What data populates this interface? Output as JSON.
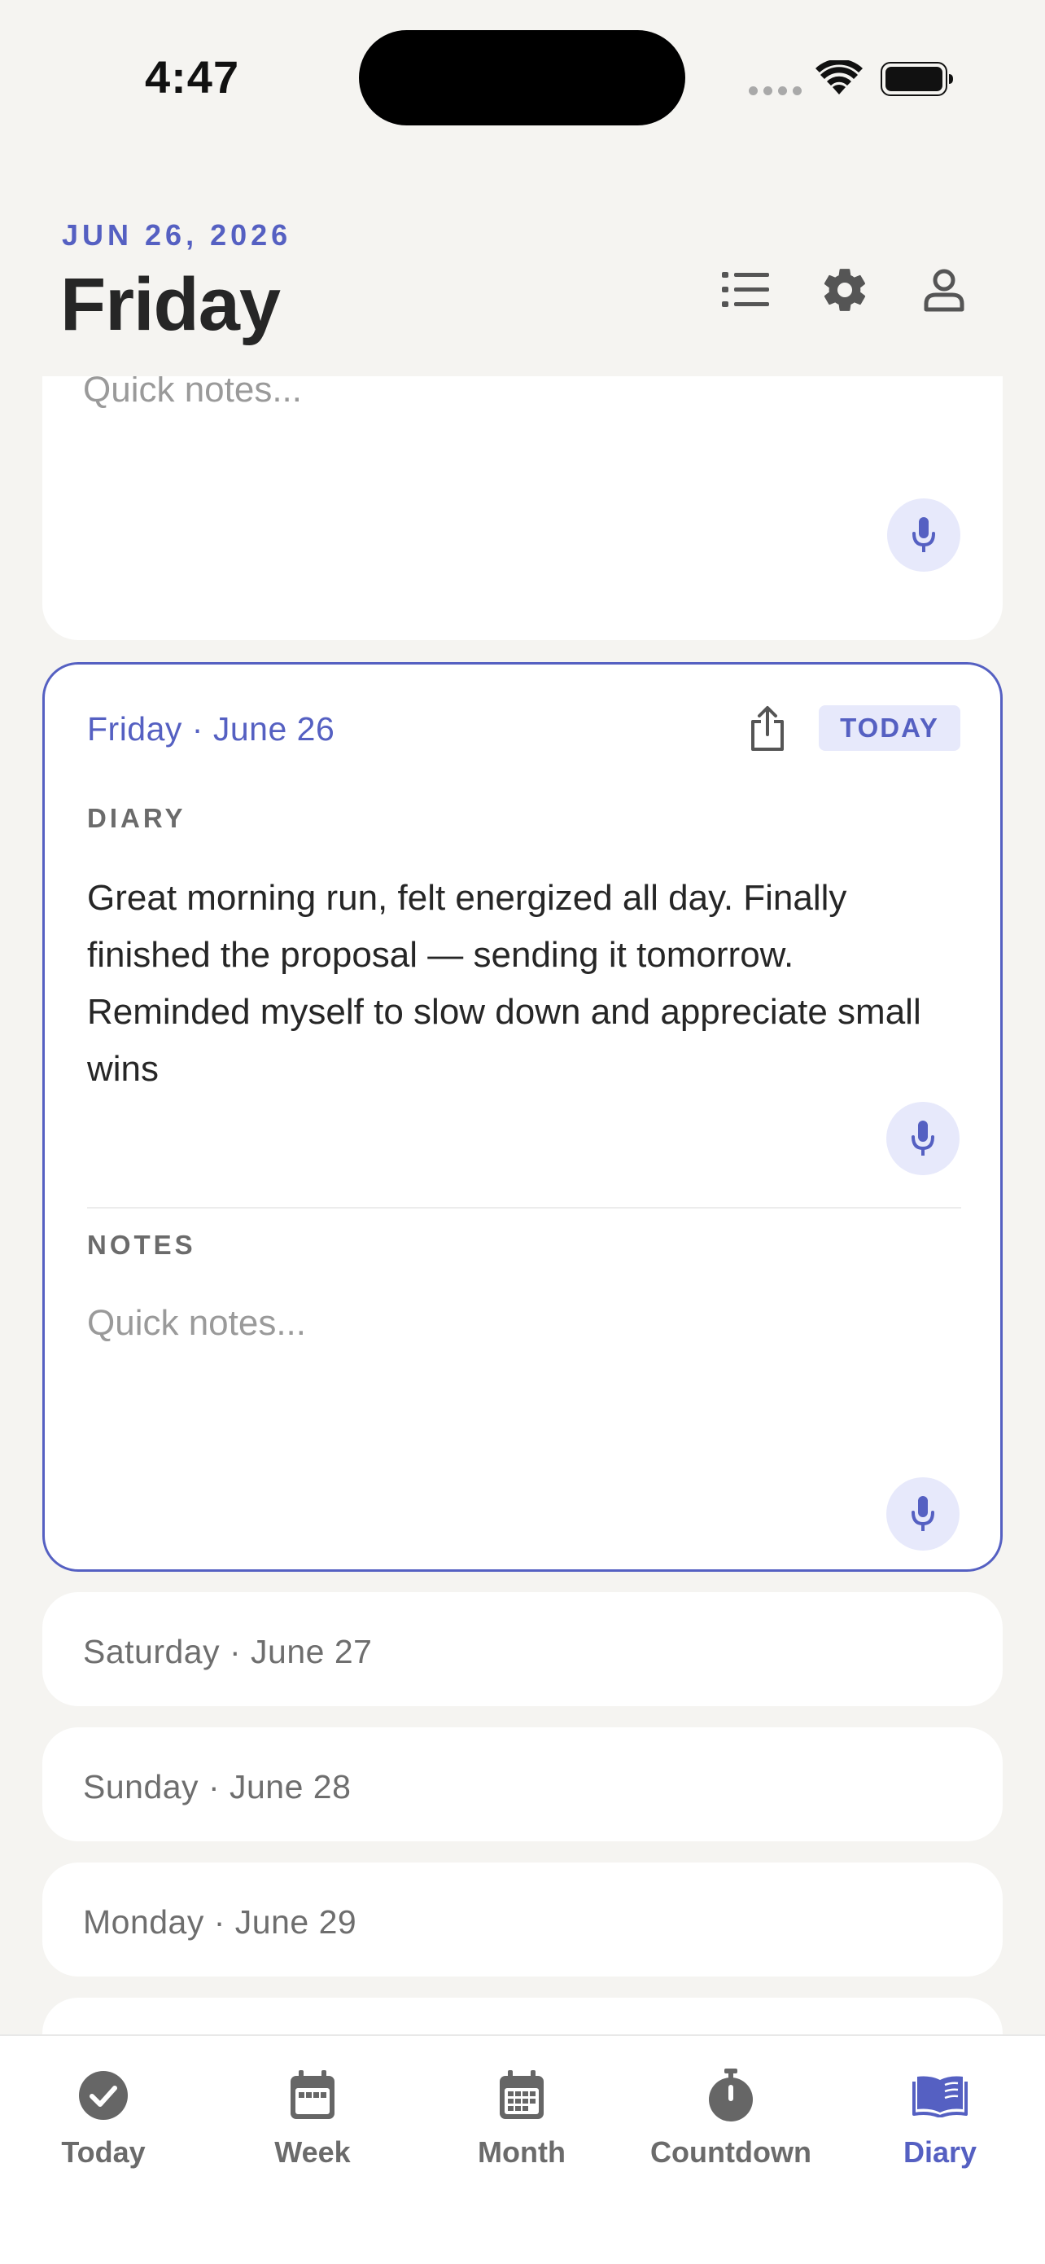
{
  "status_bar": {
    "time": "4:47"
  },
  "header": {
    "date": "JUN 26, 2026",
    "day": "Friday",
    "icons": [
      "list-icon",
      "gear-icon",
      "person-icon"
    ]
  },
  "colors": {
    "accent": "#5560c2",
    "accent_light": "#e7e9fb",
    "background": "#f5f4f1",
    "card": "#ffffff"
  },
  "prev_card": {
    "notes_placeholder": "Quick notes..."
  },
  "active_card": {
    "title": "Friday · June 26",
    "badge": "TODAY",
    "diary_label": "DIARY",
    "diary_text": "Great morning run, felt energized all day. Finally finished the proposal — sending it tomorrow. Reminded myself to slow down and appreciate small wins",
    "notes_label": "NOTES",
    "notes_placeholder": "Quick notes..."
  },
  "day_cards": [
    {
      "label": "Saturday · June 27"
    },
    {
      "label": "Sunday · June 28"
    },
    {
      "label": "Monday · June 29"
    }
  ],
  "tabs": [
    {
      "label": "Today",
      "icon": "checkmark-circle-icon",
      "active": false
    },
    {
      "label": "Week",
      "icon": "calendar-week-icon",
      "active": false
    },
    {
      "label": "Month",
      "icon": "calendar-month-icon",
      "active": false
    },
    {
      "label": "Countdown",
      "icon": "timer-icon",
      "active": false
    },
    {
      "label": "Diary",
      "icon": "book-icon",
      "active": true
    }
  ]
}
